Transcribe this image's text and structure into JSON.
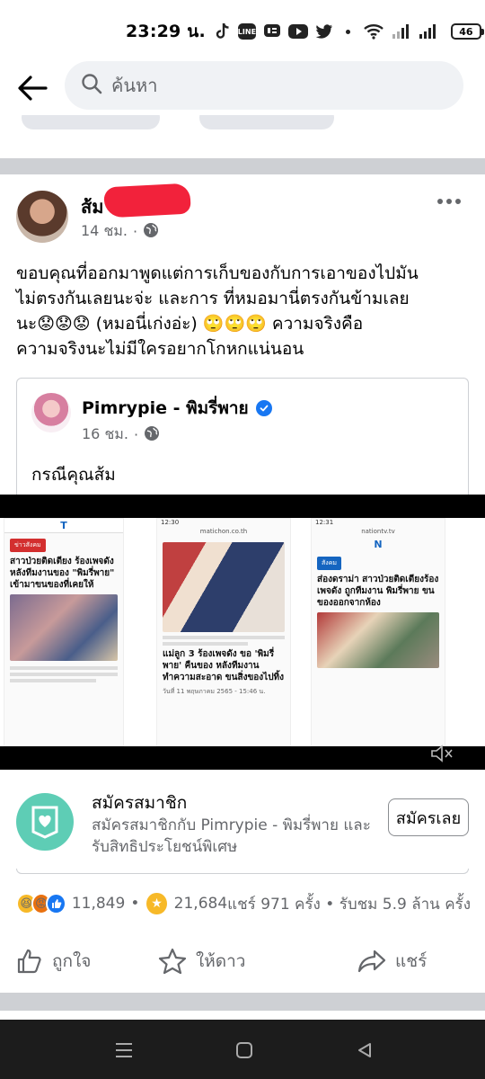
{
  "status_bar": {
    "time": "23:29 น.",
    "battery": "46",
    "app_icons": [
      "tiktok-icon",
      "line-icon",
      "line-chat-icon",
      "youtube-icon",
      "twitter-icon"
    ]
  },
  "search": {
    "placeholder": "ค้นหา"
  },
  "post": {
    "author": "ส้ม",
    "time": "14 ชม.",
    "lines": [
      "ขอบคุณที่ออกมาพูดแต่การเก็บของกับการเอาของไปมัน",
      "ไม่ตรงกันเลยนะจ่ะ และการ ที่หมอมานี่ตรงกันข้ามเลย",
      "นะ😟😟😟 (หมอนี่เก่งอ่ะ) 🙄🙄🙄     ความจริงคือ",
      "ความจริงนะไม่มีใครอยากโกหกแน่นอน"
    ]
  },
  "shared": {
    "author": "Pimrypie - พิมรี่พาย",
    "time": "16 ชม.",
    "text": "กรณีคุณส้ม"
  },
  "media": {
    "shot1": {
      "logo": "T",
      "tag": "ข่าวสังคม",
      "headline": "สาวป่วยติดเตียง ร้องเพจดัง หลังทีมงานของ \"พิมรี่พาย\" เข้ามาขนของที่เคยให้"
    },
    "shot2": {
      "time": "12:30",
      "url": "matichon.co.th",
      "headline": "แม่ลูก 3 ร้องเพจดัง ขอ 'พิมรี่พาย' คืนของ หลังทีมงานทำความสะอาด ขนสิ่งของไปทิ้ง",
      "date": "วันที่ 11 พฤษภาคม 2565 - 15:46 น."
    },
    "shot3": {
      "time": "12:31",
      "url": "nationtv.tv",
      "logo": "N",
      "tag": "สังคม",
      "headline": "ส่องดราม่า สาวป่วยติดเตียงร้องเพจดัง ถูกทีมงาน พิมรี่พาย ขนของออกจากห้อง"
    }
  },
  "membership": {
    "title": "สมัครสมาชิก",
    "subtitle": "สมัครสมาชิกกับ Pimrypie - พิมรี่พาย และรับสิทธิประโยชน์พิเศษ",
    "button": "สมัครเลย"
  },
  "reactions": {
    "count": "11,849",
    "stars": "21,684",
    "shares_views": "แชร์ 971 ครั้ง • รับชม 5.9 ล้าน ครั้ง",
    "separator": "•"
  },
  "actions": {
    "like": "ถูกใจ",
    "star": "ให้ดาว",
    "share": "แชร์"
  },
  "colors": {
    "facebook_blue": "#1877f2",
    "gray_text": "#65676b",
    "divider": "#ced0d4",
    "member_green": "#5ecdb5",
    "star_gold": "#f7b928"
  }
}
